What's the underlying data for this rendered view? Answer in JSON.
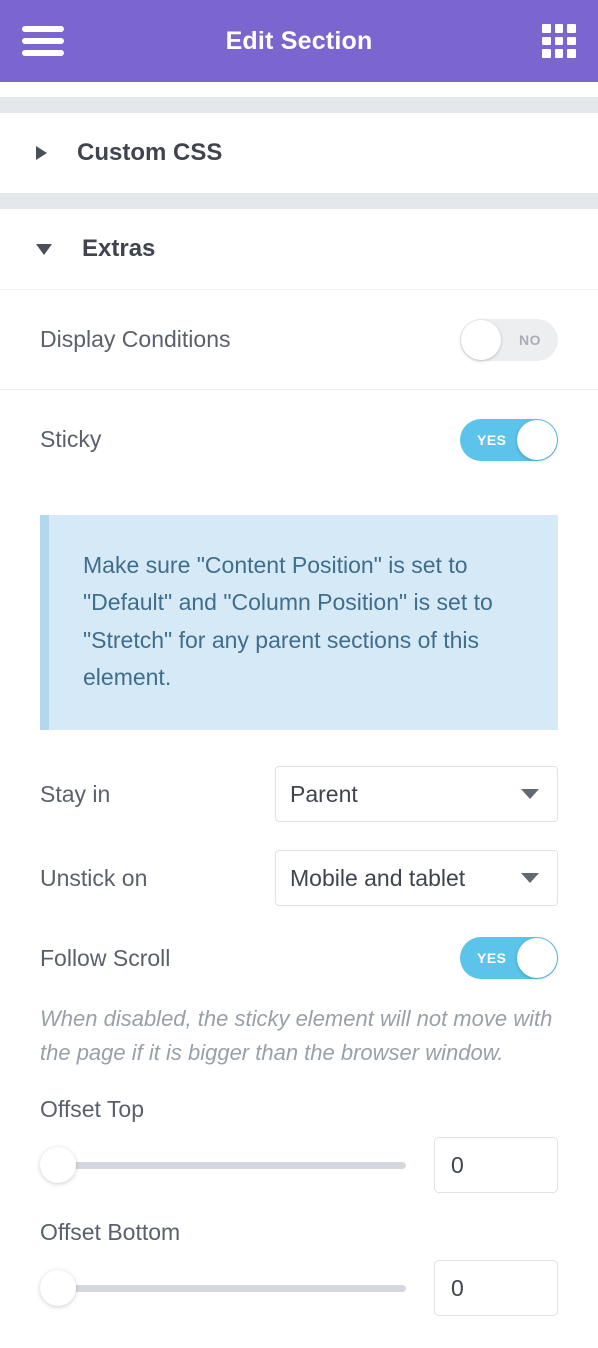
{
  "theme": {
    "header_bg": "#7a66ce",
    "toggle_on": "#5cc3ea",
    "toggle_off": "#eceef0",
    "notice_bg": "#d6e9f6",
    "notice_border": "#b3d8ee",
    "notice_text": "#3f6e8c",
    "band": "#e4e8ec"
  },
  "header": {
    "title": "Edit Section",
    "menu_icon": "hamburger-icon",
    "apps_icon": "grid-icon"
  },
  "sections": {
    "custom_css": {
      "title": "Custom CSS",
      "expanded": false,
      "caret_icon": "caret-right-icon"
    },
    "extras": {
      "title": "Extras",
      "expanded": true,
      "caret_icon": "caret-down-icon"
    }
  },
  "controls": {
    "display_conditions": {
      "label": "Display Conditions",
      "state": "NO",
      "on": false
    },
    "sticky": {
      "label": "Sticky",
      "state": "YES",
      "on": true
    },
    "notice": {
      "text": "Make sure \"Content Position\" is set to \"Default\" and \"Column Position\" is set to \"Stretch\" for any parent sections of this element."
    },
    "stay_in": {
      "label": "Stay in",
      "value": "Parent"
    },
    "unstick_on": {
      "label": "Unstick on",
      "value": "Mobile and tablet"
    },
    "follow_scroll": {
      "label": "Follow Scroll",
      "state": "YES",
      "on": true,
      "description": "When disabled, the sticky element will not move with the page if it is bigger than the browser window."
    },
    "offset_top": {
      "label": "Offset Top",
      "value": "0",
      "slider_percent": 0
    },
    "offset_bottom": {
      "label": "Offset Bottom",
      "value": "0",
      "slider_percent": 0
    }
  }
}
